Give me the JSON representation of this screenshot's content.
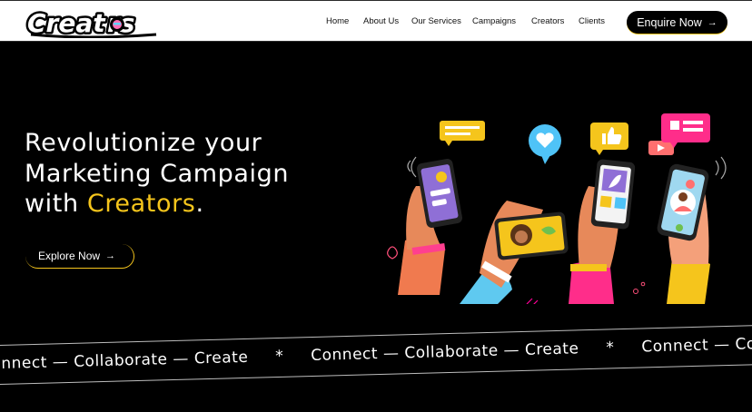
{
  "brand": {
    "logo_text": "Creators"
  },
  "nav": {
    "items": [
      "Home",
      "About Us",
      "Our Services",
      "Campaigns",
      "Creators",
      "Clients"
    ],
    "cta_label": "Enquire Now",
    "cta_icon": "arrow-right-icon"
  },
  "hero": {
    "headline_line1": "Revolutionize your",
    "headline_line2": "Marketing Campaign",
    "headline_line3_prefix": "with ",
    "headline_highlight": "Creators",
    "headline_line3_suffix": ".",
    "button_label": "Explore Now",
    "button_icon": "arrow-right-icon"
  },
  "ticker": {
    "segments": [
      "Connect — Collaborate — Create",
      "*",
      "Connect — Collaborate — Create",
      "*",
      "Connect — Collaborate — Create"
    ]
  },
  "colors": {
    "accent": "#f5c51c",
    "background": "#000000",
    "header_bg": "#ffffff"
  }
}
